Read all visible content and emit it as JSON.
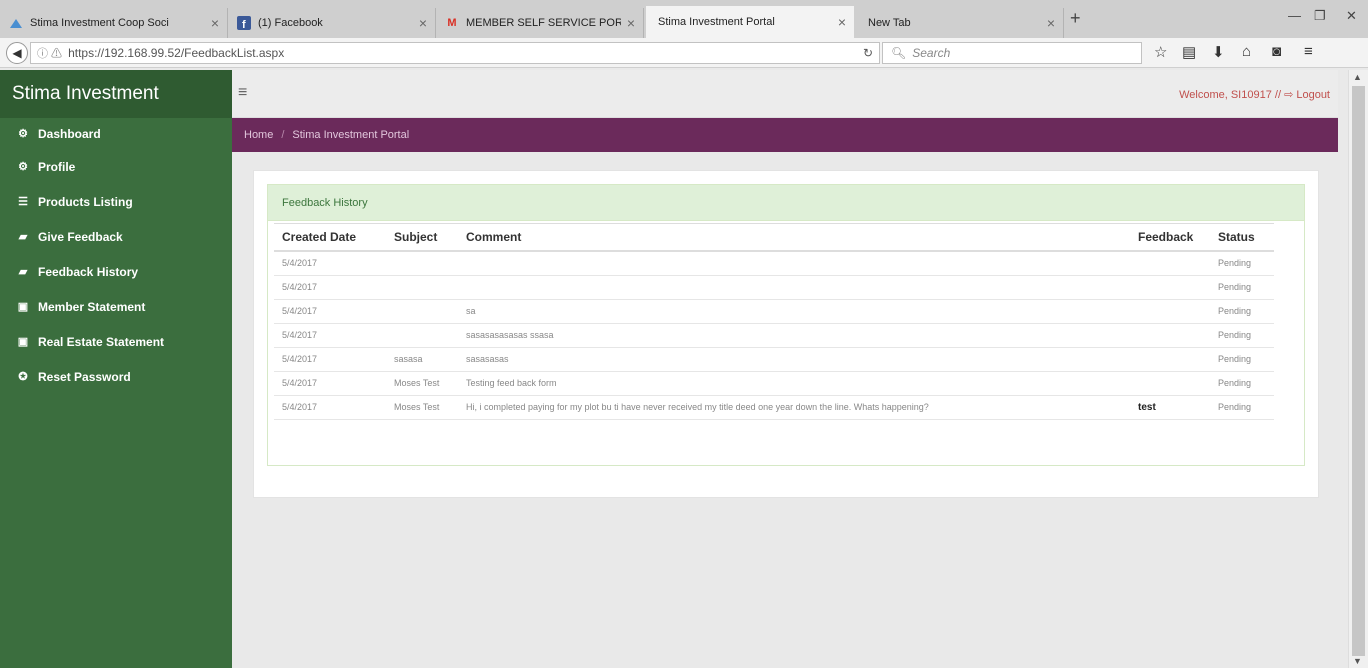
{
  "browser": {
    "tabs": [
      {
        "label": "Stima Investment Coop Soci",
        "icon": "stima-favicon",
        "active": false
      },
      {
        "label": "(1) Facebook",
        "icon": "facebook-favicon",
        "active": false
      },
      {
        "label": "MEMBER SELF SERVICE POR",
        "icon": "gmail-favicon",
        "active": false
      },
      {
        "label": "Stima Investment Portal",
        "icon": "",
        "active": true
      },
      {
        "label": "New Tab",
        "icon": "",
        "active": false
      }
    ],
    "url": "https://192.168.99.52/FeedbackList.aspx",
    "search_placeholder": "Search",
    "colors": {
      "tabbar": "#cfcfcf",
      "toolbar": "#f3f3f3"
    }
  },
  "sidebar": {
    "brand": "Stima Investment",
    "items": [
      {
        "label": "Dashboard",
        "icon": "dashboard-icon"
      },
      {
        "label": "Profile",
        "icon": "profile-icon"
      },
      {
        "label": "Products Listing",
        "icon": "list-icon"
      },
      {
        "label": "Give Feedback",
        "icon": "feedback-icon"
      },
      {
        "label": "Feedback History",
        "icon": "history-icon"
      },
      {
        "label": "Member Statement",
        "icon": "document-icon"
      },
      {
        "label": "Real Estate Statement",
        "icon": "document-icon"
      },
      {
        "label": "Reset Password",
        "icon": "reset-icon"
      }
    ],
    "colors": {
      "background": "#3b6e3e",
      "brand": "#2f5b31"
    }
  },
  "header": {
    "welcome": "Welcome, SI10917 //",
    "logout": "Logout"
  },
  "breadcrumb": {
    "home": "Home",
    "sep": "/",
    "current": "Stima Investment Portal",
    "color": "#6b2a5b"
  },
  "feedback_history": {
    "title": "Feedback History",
    "columns": [
      "Created Date",
      "Subject",
      "Comment",
      "Feedback",
      "Status"
    ],
    "rows": [
      {
        "date": "5/4/2017",
        "subject": "",
        "comment": "",
        "feedback": "",
        "status": "Pending"
      },
      {
        "date": "5/4/2017",
        "subject": "",
        "comment": "",
        "feedback": "",
        "status": "Pending"
      },
      {
        "date": "5/4/2017",
        "subject": "",
        "comment": "sa",
        "feedback": "",
        "status": "Pending"
      },
      {
        "date": "5/4/2017",
        "subject": "",
        "comment": "sasasasasasas ssasa",
        "feedback": "",
        "status": "Pending"
      },
      {
        "date": "5/4/2017",
        "subject": "sasasa",
        "comment": "sasasasas",
        "feedback": "",
        "status": "Pending"
      },
      {
        "date": "5/4/2017",
        "subject": "Moses Test",
        "comment": "Testing feed back form",
        "feedback": "",
        "status": "Pending"
      },
      {
        "date": "5/4/2017",
        "subject": "Moses Test",
        "comment": "Hi, i completed paying for my plot bu ti have never received my title deed one year down the line. Whats happening?",
        "feedback": "test",
        "status": "Pending"
      }
    ]
  }
}
